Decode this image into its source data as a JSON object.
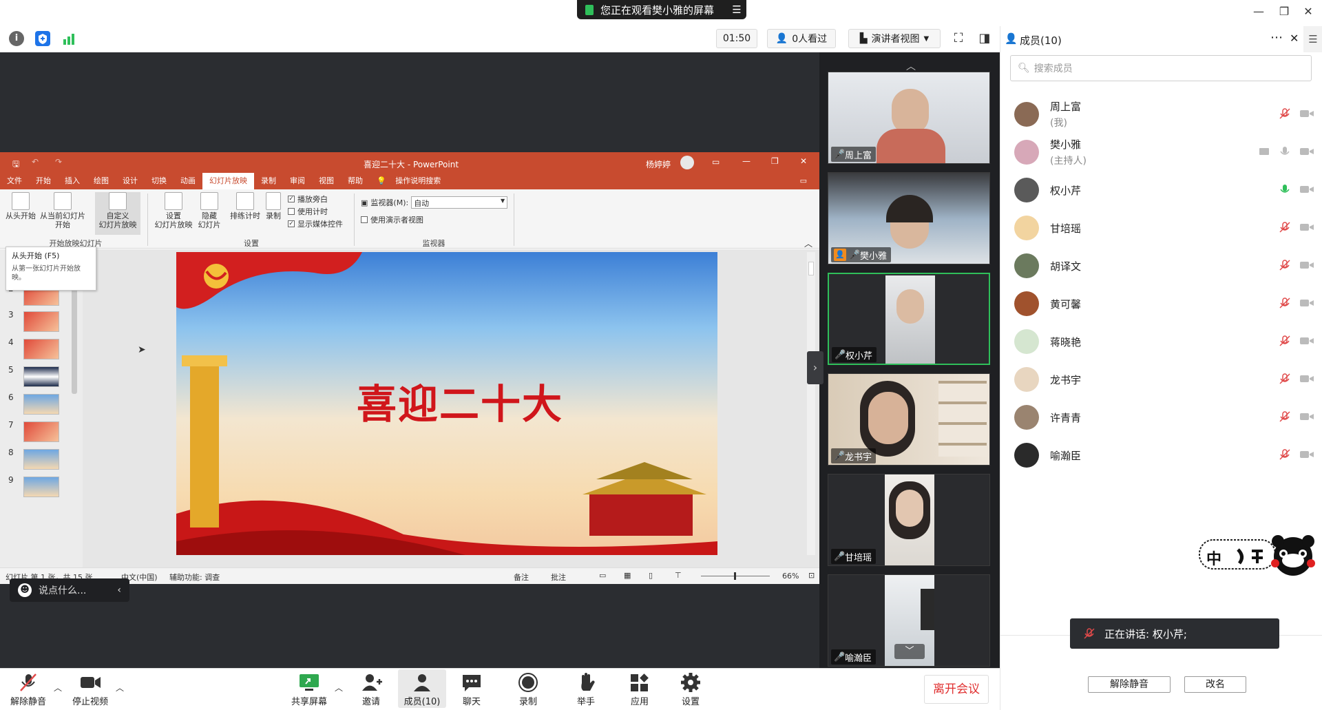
{
  "window": {
    "share_banner": "您正在观看樊小雅的屏幕",
    "share_menu_icon": "list-icon"
  },
  "toolbar": {
    "timer": "01:50",
    "viewers": "0人看过",
    "view_mode": "演讲者视图",
    "members_title": "成员(10)"
  },
  "ppt": {
    "title": "喜迎二十大 - PowerPoint",
    "user": "杨婷婷",
    "tabs": [
      "文件",
      "开始",
      "插入",
      "绘图",
      "设计",
      "切换",
      "动画",
      "幻灯片放映",
      "录制",
      "审阅",
      "视图",
      "帮助",
      "操作说明搜索"
    ],
    "active_tab": 7,
    "ribbon": {
      "btn_from_start": "从头开始",
      "btn_from_current_1": "从当前幻灯片",
      "btn_from_current_2": "开始",
      "btn_custom_1": "自定义",
      "btn_custom_2": "幻灯片放映",
      "group_start": "开始放映幻灯片",
      "btn_setup_1": "设置",
      "btn_setup_2": "幻灯片放映",
      "btn_hide_1": "隐藏",
      "btn_hide_2": "幻灯片",
      "btn_timing": "排练计时",
      "btn_record": "录制",
      "cb_narration": "播放旁白",
      "cb_timing": "使用计时",
      "cb_media": "显示媒体控件",
      "group_setup": "设置",
      "monitor_label": "监视器(M):",
      "monitor_value": "自动",
      "cb_presenter": "使用演示者视图",
      "group_monitor": "监视器"
    },
    "tooltip_title": "从头开始 (F5)",
    "tooltip_sub": "从第一张幻灯片开始放映。",
    "thumb_numbers": [
      "2",
      "3",
      "4",
      "5",
      "6",
      "7",
      "8",
      "9"
    ],
    "slide_title": "喜迎二十大",
    "status": {
      "slide_info": "幻灯片 第 1 张，共 15 张",
      "language": "中文(中国)",
      "accessibility": "辅助功能: 调查",
      "notes": "备注",
      "comments": "批注",
      "zoom": "66%"
    }
  },
  "chat_pill": {
    "placeholder": "说点什么..."
  },
  "videos": [
    {
      "name": "周上富",
      "mic": "muted"
    },
    {
      "name": "樊小雅",
      "mic": "on",
      "host": true
    },
    {
      "name": "权小芹",
      "mic": "speaking",
      "active": true
    },
    {
      "name": "龙书宇",
      "mic": "muted"
    },
    {
      "name": "甘培瑶",
      "mic": "muted"
    },
    {
      "name": "喻瀚臣",
      "mic": "muted"
    }
  ],
  "members": {
    "search_placeholder": "搜索成员",
    "list": [
      {
        "name": "周上富",
        "sub": "(我)",
        "mic": "muted",
        "color": "#8a6a55"
      },
      {
        "name": "樊小雅",
        "sub": "(主持人)",
        "mic": "off-gray",
        "color": "#d7a8b8"
      },
      {
        "name": "权小芹",
        "sub": "",
        "mic": "speaking",
        "color": "#5a5a5a"
      },
      {
        "name": "甘培瑶",
        "sub": "",
        "mic": "muted",
        "color": "#f2d4a0"
      },
      {
        "name": "胡译文",
        "sub": "",
        "mic": "muted",
        "color": "#6b7a5e"
      },
      {
        "name": "黄可馨",
        "sub": "",
        "mic": "muted",
        "color": "#a0522d"
      },
      {
        "name": "蒋晓艳",
        "sub": "",
        "mic": "muted",
        "color": "#d5e6d0"
      },
      {
        "name": "龙书宇",
        "sub": "",
        "mic": "muted",
        "color": "#e8d6c0"
      },
      {
        "name": "许青青",
        "sub": "",
        "mic": "muted",
        "color": "#9a8470"
      },
      {
        "name": "喻瀚臣",
        "sub": "",
        "mic": "muted",
        "color": "#2a2a2a"
      }
    ],
    "speaking_text": "正在讲话: 权小芹;",
    "btn_unmute_all": "解除静音",
    "btn_rename": "改名"
  },
  "sticker_text": "中",
  "bottom": {
    "unmute": "解除静音",
    "stop_video": "停止视频",
    "share": "共享屏幕",
    "invite": "邀请",
    "members": "成员(10)",
    "chat": "聊天",
    "record": "录制",
    "raise_hand": "举手",
    "apps": "应用",
    "settings": "设置",
    "leave": "离开会议"
  },
  "colors": {
    "ppt_red": "#c84b2f",
    "speaking_green": "#2fbf5a",
    "muted_red": "#e04a4a",
    "leave_red": "#e02f2f"
  }
}
